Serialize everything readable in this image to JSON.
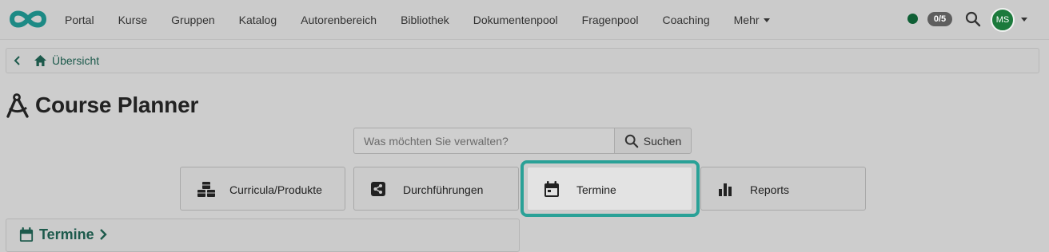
{
  "navbar": {
    "items": [
      {
        "label": "Portal"
      },
      {
        "label": "Kurse"
      },
      {
        "label": "Gruppen"
      },
      {
        "label": "Katalog"
      },
      {
        "label": "Autorenbereich"
      },
      {
        "label": "Bibliothek"
      },
      {
        "label": "Dokumentenpool"
      },
      {
        "label": "Fragenpool"
      },
      {
        "label": "Coaching"
      }
    ],
    "more_label": "Mehr",
    "badge": "0/5",
    "avatar_initials": "MS",
    "status_color": "#0f5f35",
    "avatar_color": "#1c7a3c"
  },
  "breadcrumb": {
    "back_icon": "chevron-left-icon",
    "home_icon": "home-icon",
    "label": "Übersicht"
  },
  "page": {
    "title": "Course Planner",
    "title_icon": "compass-drafting-icon"
  },
  "search": {
    "placeholder": "Was möchten Sie verwalten?",
    "value": "",
    "button_label": "Suchen"
  },
  "tiles": [
    {
      "label": "Curricula/Produkte",
      "icon": "cubes-icon"
    },
    {
      "label": "Durchführungen",
      "icon": "share-icon"
    },
    {
      "label": "Termine",
      "icon": "calendar-icon",
      "active": true
    },
    {
      "label": "Reports",
      "icon": "bar-chart-icon"
    }
  ],
  "section": {
    "label": "Termine",
    "icon": "calendar-icon"
  },
  "colors": {
    "accent": "#2aa197",
    "link": "#1d5a4c"
  }
}
